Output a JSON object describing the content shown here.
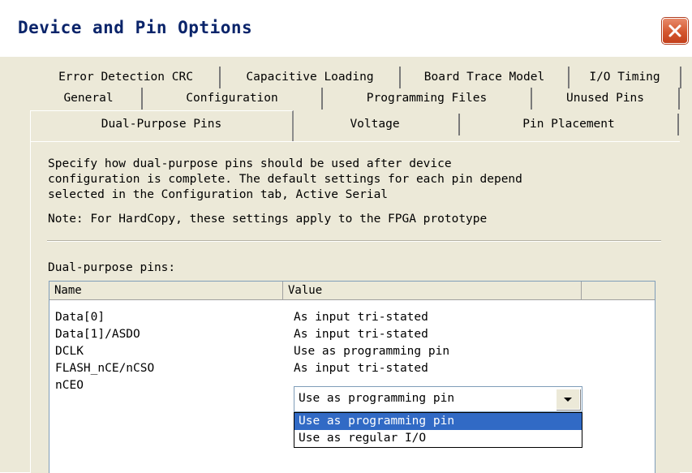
{
  "window": {
    "title": "Device and Pin Options",
    "close_icon": "close-icon"
  },
  "tabs": {
    "row1": [
      "Error Detection CRC",
      "Capacitive Loading",
      "Board Trace Model",
      "I/O Timing"
    ],
    "row2": [
      "General",
      "Configuration",
      "Programming Files",
      "Unused Pins"
    ],
    "row3": [
      "Dual-Purpose Pins",
      "Voltage",
      "Pin Placement"
    ],
    "active": "Dual-Purpose Pins"
  },
  "panel": {
    "desc_line1": "Specify how dual-purpose pins should be used after device",
    "desc_line2": "configuration is complete. The default settings for each pin depend",
    "desc_line3": "selected in the Configuration tab,  Active Serial",
    "note": "Note: For HardCopy, these settings apply to the FPGA prototype",
    "group_label": "Dual-purpose pins:"
  },
  "grid": {
    "columns": [
      "Name",
      "Value"
    ],
    "rows": [
      {
        "name": "Data[0]",
        "value": "As input tri-stated"
      },
      {
        "name": "Data[1]/ASDO",
        "value": "As input tri-stated"
      },
      {
        "name": "DCLK",
        "value": "Use as programming pin"
      },
      {
        "name": "FLASH_nCE/nCSO",
        "value": "As input tri-stated"
      },
      {
        "name": "nCEO",
        "value": "Use as programming pin"
      }
    ]
  },
  "combo": {
    "selected": "Use as programming pin",
    "options": [
      "Use as programming pin",
      "Use as regular I/O"
    ],
    "highlight_color": "#316ac5"
  }
}
